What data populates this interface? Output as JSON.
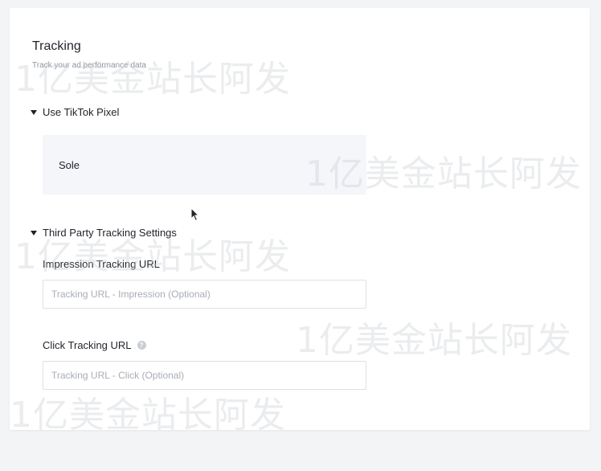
{
  "tracking": {
    "title": "Tracking",
    "subtitle": "Track your ad performance data"
  },
  "pixel_section": {
    "toggle_label": "Use TikTok Pixel",
    "selected_pixel": "Sole"
  },
  "third_party_section": {
    "toggle_label": "Third Party Tracking Settings",
    "impression": {
      "label": "Impression Tracking URL",
      "placeholder": "Tracking URL - Impression (Optional)",
      "value": ""
    },
    "click": {
      "label": "Click Tracking URL",
      "help_glyph": "?",
      "placeholder": "Tracking URL - Click (Optional)",
      "value": ""
    }
  },
  "watermark": {
    "text": "1亿美金站长阿发"
  },
  "colors": {
    "text_primary": "#1f2329",
    "text_secondary": "#8f959e",
    "panel_bg": "#f5f6fa",
    "input_border": "#dee0e3"
  }
}
